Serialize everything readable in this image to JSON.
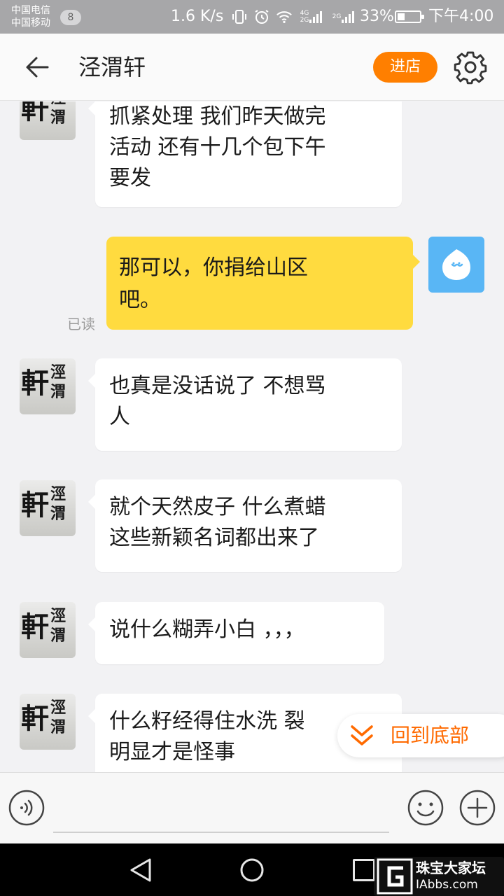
{
  "status_bar": {
    "carrier_1": "中国电信",
    "carrier_2": "中国移动",
    "sim_badge": "8",
    "net_speed": "1.6 K/s",
    "net_4g": "4G",
    "net_2g_small": "2G",
    "net_2g": "2G",
    "battery_percent": "33%",
    "battery_level": 0.33,
    "time": "下午4:00",
    "icons": [
      "vibrate-icon",
      "alarm-icon",
      "wifi-icon",
      "signal-4g-icon",
      "signal-2g-icon",
      "battery-icon"
    ]
  },
  "header": {
    "title": "泾渭轩",
    "enter_store_label": "进店",
    "icons": [
      "back-arrow-icon",
      "gear-icon"
    ]
  },
  "shop_avatar": {
    "big_char": "軒",
    "small_chars": "涇渭"
  },
  "messages": [
    {
      "from": "shop",
      "text": "抓紧处理 我们昨天做完\n活动 还有十几个包下午\n要发"
    },
    {
      "from": "me",
      "text": "那可以，你捐给山区\n吧。",
      "read_status": "已读"
    },
    {
      "from": "shop",
      "text": "也真是没话说了  不想骂\n人"
    },
    {
      "from": "shop",
      "text": "就个天然皮子 什么煮蜡\n这些新颖名词都出来了"
    },
    {
      "from": "shop",
      "text": "说什么糊弄小白 ，，，"
    },
    {
      "from": "shop",
      "text": "什么籽经得住水洗 裂\n明显才是怪事"
    }
  ],
  "back_to_bottom_label": "回到底部",
  "input_bar": {
    "placeholder": "",
    "icons": [
      "voice-icon",
      "emoji-icon",
      "plus-icon"
    ]
  },
  "nav_bar": {
    "icons": [
      "nav-back-icon",
      "nav-home-icon",
      "nav-recent-icon"
    ]
  },
  "watermark": {
    "title": "珠宝大家坛",
    "url": "IAbbs.com"
  },
  "colors": {
    "accent_orange": "#ff7f00",
    "my_bubble": "#ffdb3f",
    "my_avatar": "#59b6f5",
    "back_to_bottom_text": "#ff6a00"
  }
}
